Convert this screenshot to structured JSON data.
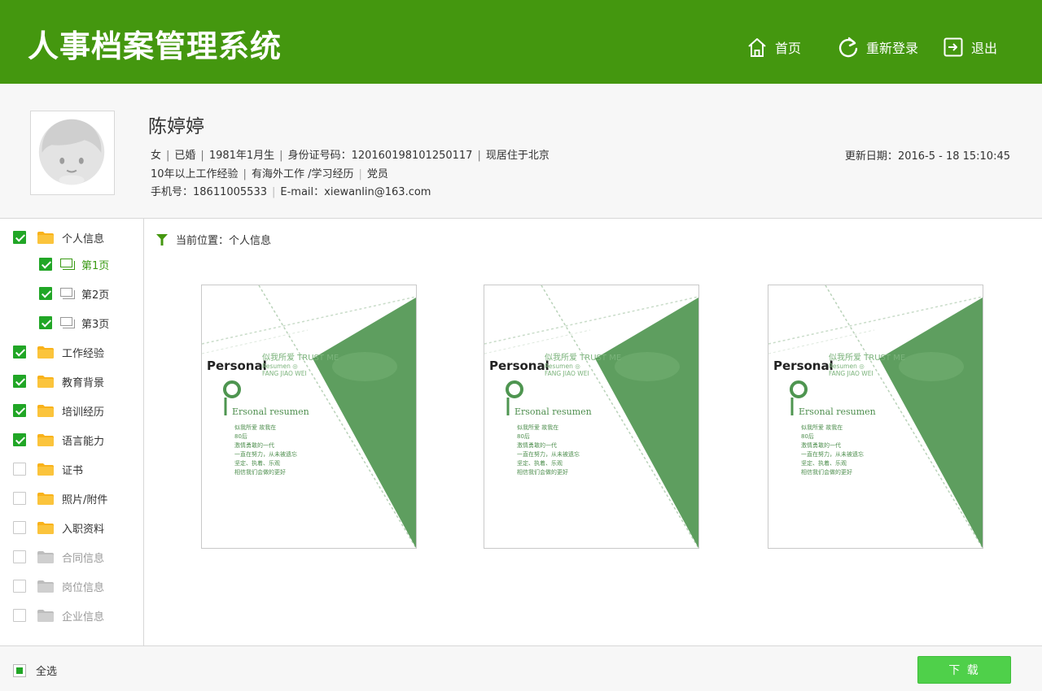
{
  "header": {
    "title": "人事档案管理系统",
    "nav": {
      "home": "首页",
      "relogin": "重新登录",
      "logout": "退出"
    }
  },
  "profile": {
    "name": "陈婷婷",
    "gender": "女",
    "marital": "已婚",
    "birth": "1981年1月生",
    "id_label": "身份证号码：",
    "id_number": "120160198101250117",
    "residence": "现居住于北京",
    "experience": "10年以上工作经验",
    "overseas": "有海外工作 /学习经历",
    "party": "党员",
    "phone_label": "手机号：",
    "phone": "18611005533",
    "email_label": "E-mail：",
    "email": "xiewanlin@163.com",
    "update_label": "更新日期：",
    "update_date": "2016-5 - 18 15:10:45"
  },
  "sidebar": {
    "items": [
      {
        "label": "个人信息",
        "checked": true,
        "level": 0,
        "type": "folder",
        "state": "normal"
      },
      {
        "label": "第1页",
        "checked": true,
        "level": 1,
        "type": "page",
        "state": "active"
      },
      {
        "label": "第2页",
        "checked": true,
        "level": 1,
        "type": "page",
        "state": "normal"
      },
      {
        "label": "第3页",
        "checked": true,
        "level": 1,
        "type": "page",
        "state": "normal"
      },
      {
        "label": "工作经验",
        "checked": true,
        "level": 0,
        "type": "folder",
        "state": "normal"
      },
      {
        "label": "教育背景",
        "checked": true,
        "level": 0,
        "type": "folder",
        "state": "normal"
      },
      {
        "label": "培训经历",
        "checked": true,
        "level": 0,
        "type": "folder",
        "state": "normal"
      },
      {
        "label": "语言能力",
        "checked": true,
        "level": 0,
        "type": "folder",
        "state": "normal"
      },
      {
        "label": "证书",
        "checked": false,
        "level": 0,
        "type": "folder",
        "state": "normal"
      },
      {
        "label": "照片/附件",
        "checked": false,
        "level": 0,
        "type": "folder",
        "state": "normal"
      },
      {
        "label": "入职资料",
        "checked": false,
        "level": 0,
        "type": "folder",
        "state": "normal"
      },
      {
        "label": "合同信息",
        "checked": false,
        "level": 0,
        "type": "folder",
        "state": "disabled"
      },
      {
        "label": "岗位信息",
        "checked": false,
        "level": 0,
        "type": "folder",
        "state": "disabled"
      },
      {
        "label": "企业信息",
        "checked": false,
        "level": 0,
        "type": "folder",
        "state": "disabled"
      }
    ]
  },
  "main": {
    "breadcrumb": "当前位置：个人信息",
    "thumb_text": {
      "personal": "Personal",
      "trust": "似我所爱  TRUST ME",
      "sub": "Resumen ◎\nFANG JIAO WEI",
      "ersonal": "Ersonal resumen",
      "lines": "似我所爱 故我在\n80后\n激情勇敢的一代\n一直在努力，从未被遗忘\n坚定、执着、乐观\n相信我们会做的更好"
    }
  },
  "footer": {
    "select_all": "全选",
    "download": "下 载"
  },
  "colors": {
    "header_bg": "#44970f",
    "checkbox": "#21a626",
    "folder": "#f9b21a",
    "folder_disabled": "#cfcfcf",
    "active_link": "#3a9a14",
    "download_bg": "#4fd04a",
    "thumb_green": "#4e9550"
  }
}
